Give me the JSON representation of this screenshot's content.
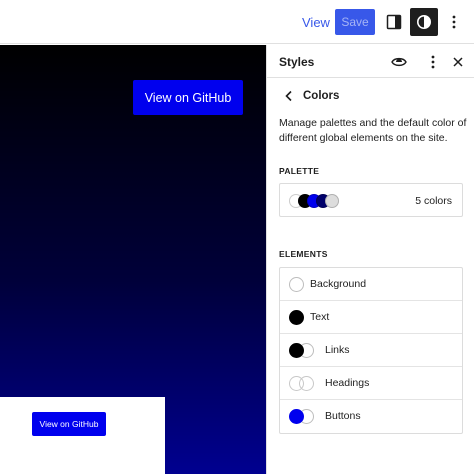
{
  "toolbar": {
    "view_label": "View",
    "save_label": "Save",
    "sidebar_toggle_icon": "sidebar-icon",
    "styles_icon": "half-circle-contrast-icon",
    "more_icon": "vertical-ellipsis-icon"
  },
  "canvas": {
    "github_button_large": "View on GitHub",
    "github_button_small": "View on GitHub",
    "gradient_colors": [
      "#000000",
      "#00003a",
      "#000090"
    ],
    "button_color": "#0000ee"
  },
  "sidebar": {
    "title": "Styles",
    "icons": [
      "eye-icon",
      "vertical-ellipsis-icon",
      "close-icon"
    ],
    "back_icon": "chevron-left-icon",
    "panel_title": "Colors",
    "description": "Manage palettes and the default color of different global elements on the site.",
    "palette": {
      "label": "Palette",
      "count_label": "5 colors",
      "swatches": [
        "#ffffff",
        "#000000",
        "#0000ee",
        "#00006a",
        "#dddddd"
      ]
    },
    "elements": {
      "label": "Elements",
      "items": [
        {
          "label": "Background",
          "indicator": "empty"
        },
        {
          "label": "Text",
          "indicator": "black"
        },
        {
          "label": "Links",
          "indicator": "black-white"
        },
        {
          "label": "Headings",
          "indicator": "empty-pair"
        },
        {
          "label": "Buttons",
          "indicator": "blue-white"
        }
      ]
    }
  },
  "accent_color": "#3858e9"
}
